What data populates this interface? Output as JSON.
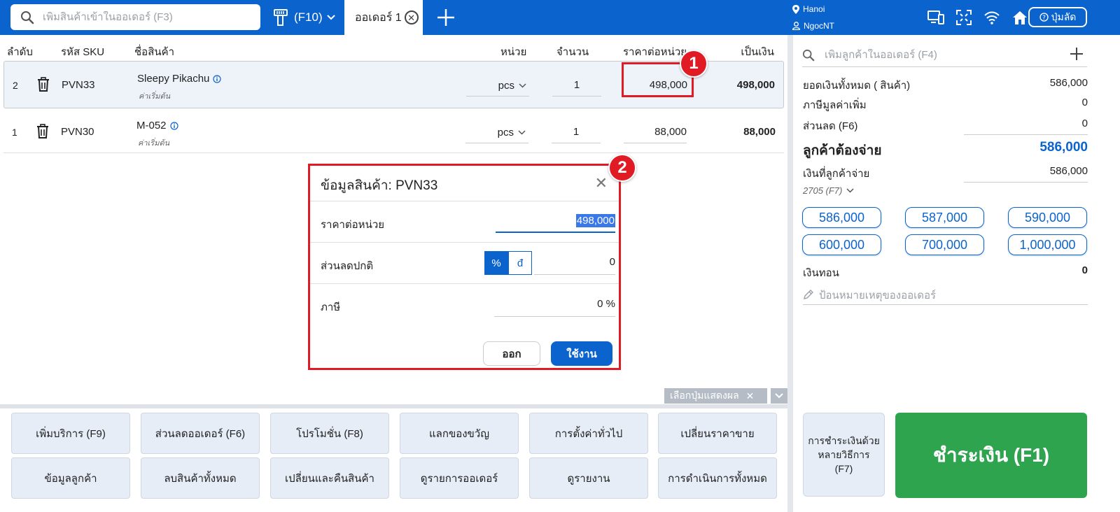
{
  "topbar": {
    "search_placeholder": "เพิ่มสินค้าเข้าในออเดอร์ (F3)",
    "scan_label": "(F10)",
    "tab_label": "ออเดอร์ 1",
    "location": "Hanoi",
    "user": "NgocNT",
    "shortcut_label": "ปุ่มลัด"
  },
  "table": {
    "headers": [
      "ลำดับ",
      "รหัส SKU",
      "ชื่อสินค้า",
      "หน่วย",
      "จำนวน",
      "ราคาต่อหน่วย",
      "เป็นเงิน"
    ],
    "rows": [
      {
        "idx": "2",
        "sku": "PVN33",
        "name": "Sleepy Pikachu",
        "note": "ค่าเริ่มต้น",
        "unit": "pcs",
        "qty": "1",
        "price": "498,000",
        "total": "498,000"
      },
      {
        "idx": "1",
        "sku": "PVN30",
        "name": "M-052",
        "note": "ค่าเริ่มต้น",
        "unit": "pcs",
        "qty": "1",
        "price": "88,000",
        "total": "88,000"
      }
    ]
  },
  "annotations": {
    "badge1": "1",
    "badge2": "2"
  },
  "dialog": {
    "title": "ข้อมูลสินค้า: PVN33",
    "price_label": "ราคาต่อหน่วย",
    "price_value": "498,000",
    "discount_label": "ส่วนลดปกติ",
    "pct_symbol": "%",
    "currency_symbol": "đ",
    "discount_value": "0",
    "tax_label": "ภาษี",
    "tax_value": "0 %",
    "exit_label": "ออก",
    "apply_label": "ใช้งาน"
  },
  "quick_select_label": "เลือกปุ่มแสดงผล",
  "function_buttons": [
    "เพิ่มบริการ (F9)",
    "ส่วนลดออเดอร์ (F6)",
    "โปรโมชั่น (F8)",
    "แลกของขวัญ",
    "การตั้งค่าทั่วไป",
    "เปลี่ยนราคาขาย",
    "ข้อมูลลูกค้า",
    "ลบสินค้าทั้งหมด",
    "เปลี่ยนและคืนสินค้า",
    "ดูรายการออเดอร์",
    "ดูรายงาน",
    "การดำเนินการทั้งหมด"
  ],
  "summary": {
    "customer_search_placeholder": "เพิ่มลูกค้าในออเดอร์ (F4)",
    "total_label": "ยอดเงินทั้งหมด ( สินค้า)",
    "total_value": "586,000",
    "vat_label": "ภาษีมูลค่าเพิ่ม",
    "vat_value": "0",
    "discount_label": "ส่วนลด (F6)",
    "discount_value": "0",
    "customer_pay_label": "ลูกค้าต้องจ่าย",
    "customer_pay_value": "586,000",
    "customer_paid_label": "เงินที่ลูกค้าจ่าย",
    "customer_paid_value": "586,000",
    "payment_method": "2705 (F7)",
    "quick_amounts": [
      "586,000",
      "587,000",
      "590,000",
      "600,000",
      "700,000",
      "1,000,000"
    ],
    "change_label": "เงินทอน",
    "change_value": "0",
    "note_placeholder": "ป้อนหมายเหตุของออเดอร์",
    "multi_pay_label": "การชำระเงินด้วยหลายวิธีการ (F7)",
    "pay_button_label": "ชำระเงิน (F1)"
  },
  "colors": {
    "primary": "#0b63ce",
    "pay_green": "#2ea44f",
    "highlight_red": "#e01b24"
  }
}
